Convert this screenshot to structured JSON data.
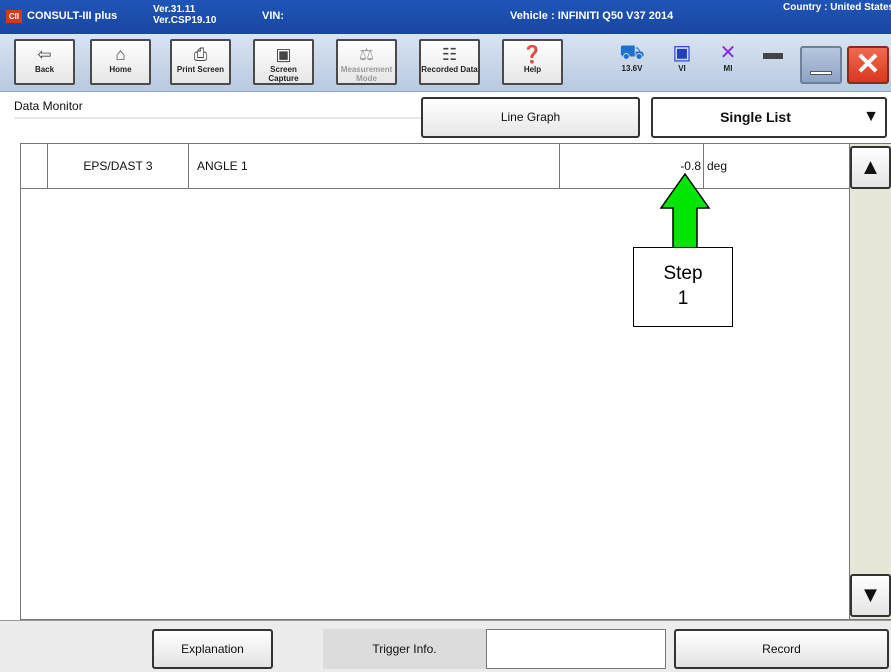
{
  "titlebar": {
    "app_name": "CONSULT-III plus",
    "logo_text": "CII",
    "version_1": "Ver.31.11",
    "version_2": "Ver.CSP19.10",
    "vin_label": "VIN:",
    "vehicle": "Vehicle : INFINITI Q50 V37 2014",
    "country": "Country : United States"
  },
  "toolbar": {
    "buttons": [
      {
        "label": "Back",
        "icon": "back-arrow-icon",
        "glyph": "⇦",
        "disabled": false
      },
      {
        "label": "Home",
        "icon": "home-icon",
        "glyph": "⌂",
        "disabled": false
      },
      {
        "label": "Print Screen",
        "icon": "printer-icon",
        "glyph": "⎙",
        "disabled": false
      },
      {
        "label": "Screen Capture",
        "icon": "camera-icon",
        "glyph": "▣",
        "disabled": false
      },
      {
        "label": "Measurement Mode",
        "icon": "measurement-icon",
        "glyph": "⚖",
        "disabled": true
      },
      {
        "label": "Recorded Data",
        "icon": "recorded-data-icon",
        "glyph": "☷",
        "disabled": false
      },
      {
        "label": "Help",
        "icon": "help-icon",
        "glyph": "❓",
        "disabled": false
      }
    ],
    "status": {
      "battery_voltage": "13.6V",
      "vi_label": "VI",
      "mi_label": "MI"
    }
  },
  "header": {
    "title": "Data Monitor",
    "line_graph_label": "Line Graph",
    "display_mode": "Single List"
  },
  "data_rows": [
    {
      "system": "EPS/DAST 3",
      "item": "ANGLE 1",
      "value": "-0.8",
      "unit": "deg"
    }
  ],
  "annotation": {
    "step_line1": "Step",
    "step_line2": "1",
    "arrow_color": "#00e600"
  },
  "footer": {
    "explanation_label": "Explanation",
    "trigger_label": "Trigger Info.",
    "trigger_value": "",
    "record_label": "Record"
  },
  "colors": {
    "titlebar": "#1f55b8",
    "close_button": "#e0482c"
  }
}
